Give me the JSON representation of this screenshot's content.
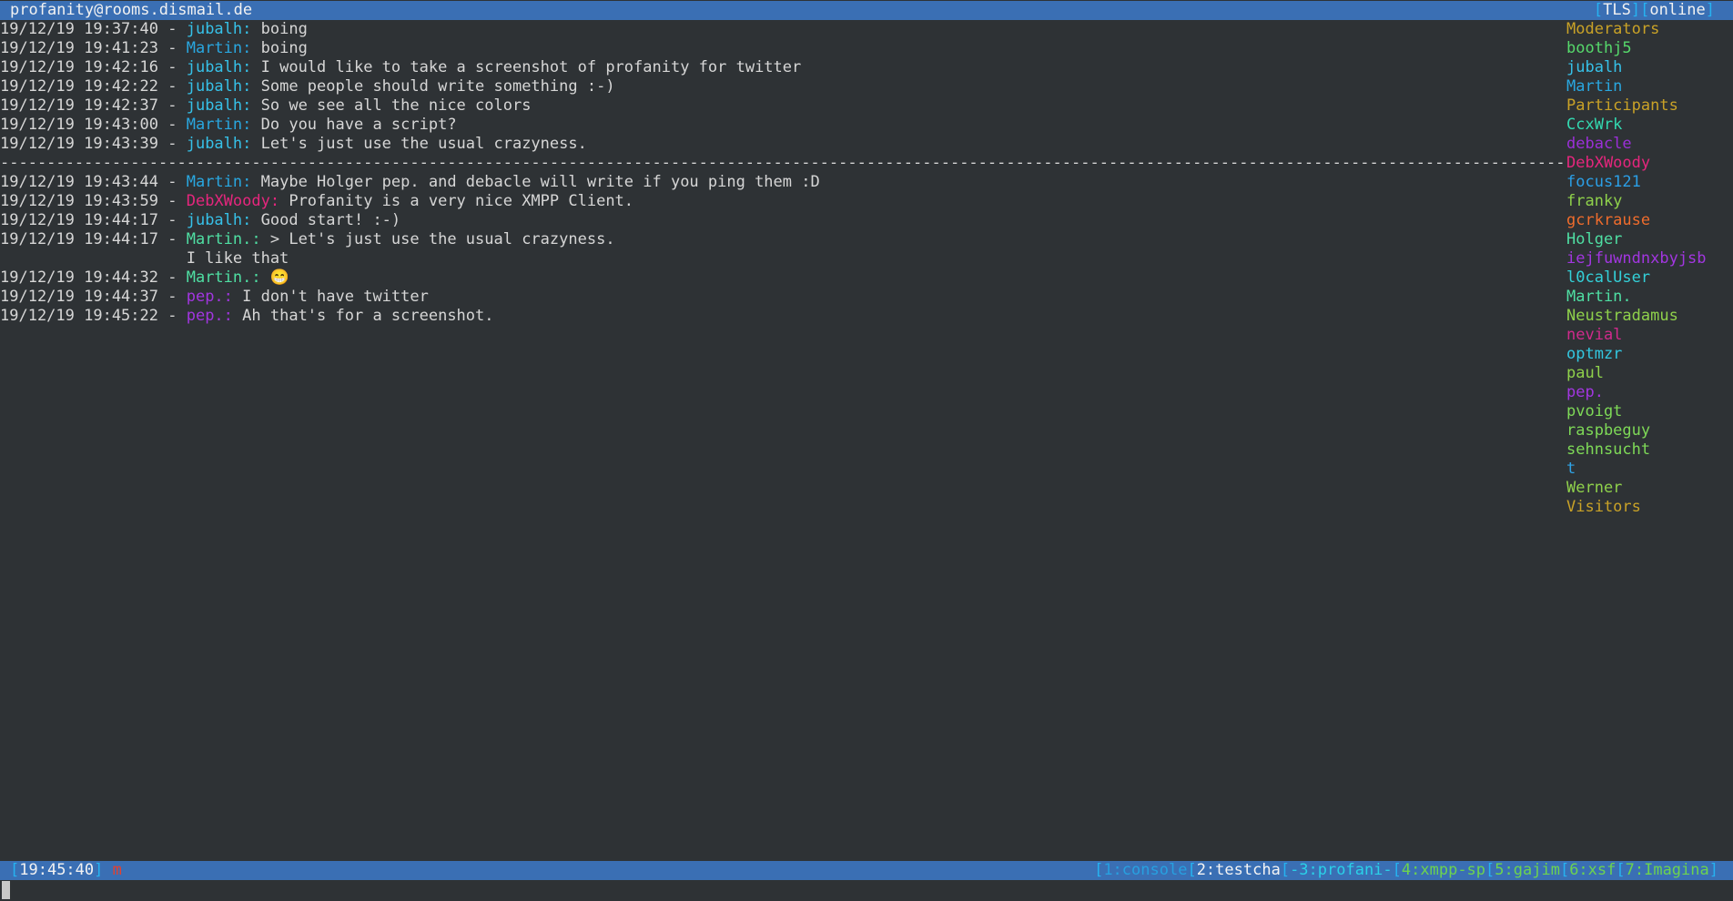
{
  "titlebar": {
    "room": "profanity@rooms.dismail.de",
    "tls": "TLS",
    "status": "online"
  },
  "colors": {
    "bar": "#3a6fb4",
    "background": "#2e3235",
    "text": "#d6d6d6",
    "jubalh": "#36c1e8",
    "martin": "#29a7e0",
    "martin_dot": "#4fdfa3",
    "debxwoody": "#e5267d",
    "pep": "#a236e0",
    "role_header": "#c9a227"
  },
  "chat": {
    "separator": "------------------------------------------------------------------------------------------------------------------------------------------------------------------------",
    "messages": [
      {
        "ts": "19/12/19 19:37:40",
        "nick": "jubalh:",
        "text": "boing",
        "color": "#36c1e8"
      },
      {
        "ts": "19/12/19 19:41:23",
        "nick": "Martin:",
        "text": "boing",
        "color": "#29a7e0"
      },
      {
        "ts": "19/12/19 19:42:16",
        "nick": "jubalh:",
        "text": "I would like to take a screenshot of profanity for twitter",
        "color": "#36c1e8"
      },
      {
        "ts": "19/12/19 19:42:22",
        "nick": "jubalh:",
        "text": "Some people should write something :-)",
        "color": "#36c1e8"
      },
      {
        "ts": "19/12/19 19:42:37",
        "nick": "jubalh:",
        "text": "So we see all the nice colors",
        "color": "#36c1e8"
      },
      {
        "ts": "19/12/19 19:43:00",
        "nick": "Martin:",
        "text": "Do you have a script?",
        "color": "#29a7e0"
      },
      {
        "ts": "19/12/19 19:43:39",
        "nick": "jubalh:",
        "text": "Let's just use the usual crazyness.",
        "color": "#36c1e8"
      }
    ],
    "messages_after": [
      {
        "ts": "19/12/19 19:43:44",
        "nick": "Martin:",
        "text": "Maybe Holger pep. and debacle will write if you ping them :D",
        "color": "#29a7e0"
      },
      {
        "ts": "19/12/19 19:43:59",
        "nick": "DebXWoody:",
        "text": "Profanity is a very nice XMPP Client.",
        "color": "#e5267d"
      },
      {
        "ts": "19/12/19 19:44:17",
        "nick": "jubalh:",
        "text": "Good start! :-)",
        "color": "#36c1e8"
      },
      {
        "ts": "19/12/19 19:44:17",
        "nick": "Martin.:",
        "text": "> Let's just use the usual crazyness.",
        "color": "#4fdfa3"
      },
      {
        "ts": "",
        "nick": "",
        "text": "I like that",
        "color": "#d6d6d6",
        "continuation": true
      },
      {
        "ts": "19/12/19 19:44:32",
        "nick": "Martin.:",
        "text": "😁",
        "color": "#4fdfa3"
      },
      {
        "ts": "19/12/19 19:44:37",
        "nick": "pep.:",
        "text": "I don't have twitter",
        "color": "#a236e0"
      },
      {
        "ts": "19/12/19 19:45:22",
        "nick": "pep.:",
        "text": "Ah that's for a screenshot.",
        "color": "#a236e0"
      }
    ]
  },
  "occupants": [
    {
      "name": "Moderators",
      "color": "#c9a227",
      "header": true
    },
    {
      "name": "boothj5",
      "color": "#56d86b"
    },
    {
      "name": "jubalh",
      "color": "#36c1e8"
    },
    {
      "name": "Martin",
      "color": "#29a7e0"
    },
    {
      "name": "Participants",
      "color": "#c9a227",
      "header": true
    },
    {
      "name": "CcxWrk",
      "color": "#33d9b0"
    },
    {
      "name": "debacle",
      "color": "#9b2fd8"
    },
    {
      "name": "DebXWoody",
      "color": "#e5267d"
    },
    {
      "name": "focus121",
      "color": "#2b9fe6"
    },
    {
      "name": "franky",
      "color": "#8fd14b"
    },
    {
      "name": "gcrkrause",
      "color": "#ef6c2c"
    },
    {
      "name": "Holger",
      "color": "#4fdfa3"
    },
    {
      "name": "iejfuwndnxbyjsb",
      "color": "#a236e0"
    },
    {
      "name": "l0calUser",
      "color": "#33d0d8"
    },
    {
      "name": "Martin.",
      "color": "#4fdfa3"
    },
    {
      "name": "Neustradamus",
      "color": "#8fd14b"
    },
    {
      "name": "nevial",
      "color": "#d02a8c"
    },
    {
      "name": "optmzr",
      "color": "#33c7e0"
    },
    {
      "name": "paul",
      "color": "#8fd14b"
    },
    {
      "name": "pep.",
      "color": "#a236e0"
    },
    {
      "name": "pvoigt",
      "color": "#7ed957"
    },
    {
      "name": "raspbeguy",
      "color": "#7ed957"
    },
    {
      "name": "sehnsucht",
      "color": "#7ed957"
    },
    {
      "name": "t",
      "color": "#2fa3e6"
    },
    {
      "name": "Werner",
      "color": "#8fd14b"
    },
    {
      "name": "Visitors",
      "color": "#c9a227",
      "header": true
    }
  ],
  "statusbar": {
    "time": "19:45:40",
    "mode": "m",
    "tabs": [
      {
        "label": "1:console",
        "active": false,
        "color": "#27a0e0"
      },
      {
        "label": "2:testcha",
        "active": true,
        "color": "#f4f4f4"
      },
      {
        "label": "-3:profani-",
        "active": false,
        "color": "#2ad1e8"
      },
      {
        "label": "4:xmpp-sp",
        "active": false,
        "color": "#6dd34f"
      },
      {
        "label": "5:gajim",
        "active": false,
        "color": "#6dd34f"
      },
      {
        "label": "6:xsf",
        "active": false,
        "color": "#6dd34f"
      },
      {
        "label": "7:Imagina",
        "active": false,
        "color": "#6dd34f"
      }
    ]
  }
}
